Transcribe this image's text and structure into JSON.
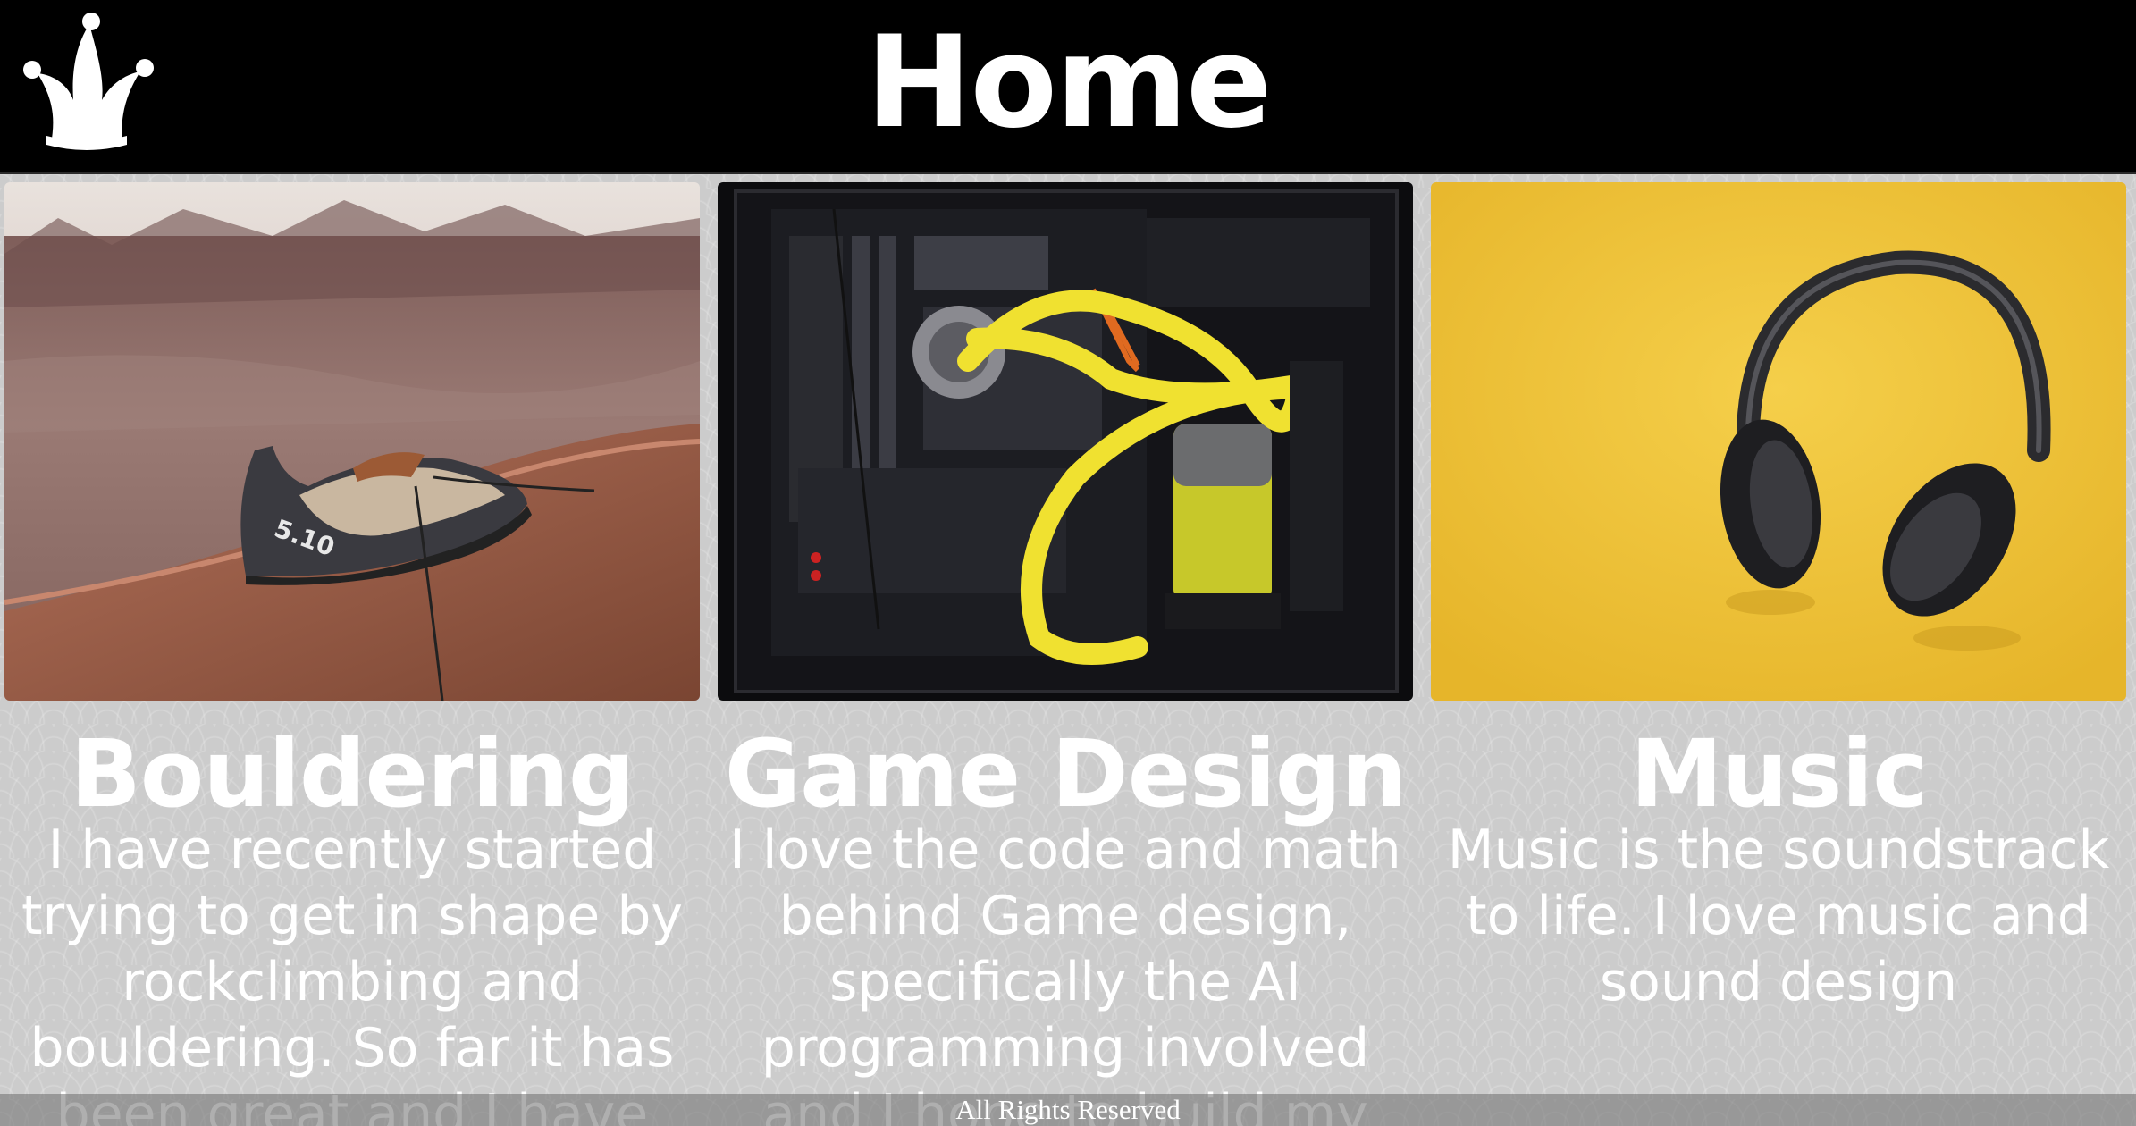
{
  "header": {
    "title": "Home",
    "logo_icon": "jester-hat-icon"
  },
  "cards": [
    {
      "title": "Bouldering",
      "image": "climbing-shoe-on-rock-photo",
      "text": "I have recently started trying to get in shape by rockclimbing and bouldering. So far it has been great and I have"
    },
    {
      "title": "Game Design",
      "image": "water-cooled-pc-interior-photo",
      "text": "I love the code and math behind Game design, specifically the AI programming involved and I hope to build my"
    },
    {
      "title": "Music",
      "image": "headphones-on-yellow-photo",
      "text": "Music is the soundstrack to life. I love music and sound design"
    }
  ],
  "footer": {
    "text": "All Rights Reserved"
  },
  "colors": {
    "header_bg": "#000000",
    "page_bg": "#cccccc",
    "text": "#ffffff"
  }
}
